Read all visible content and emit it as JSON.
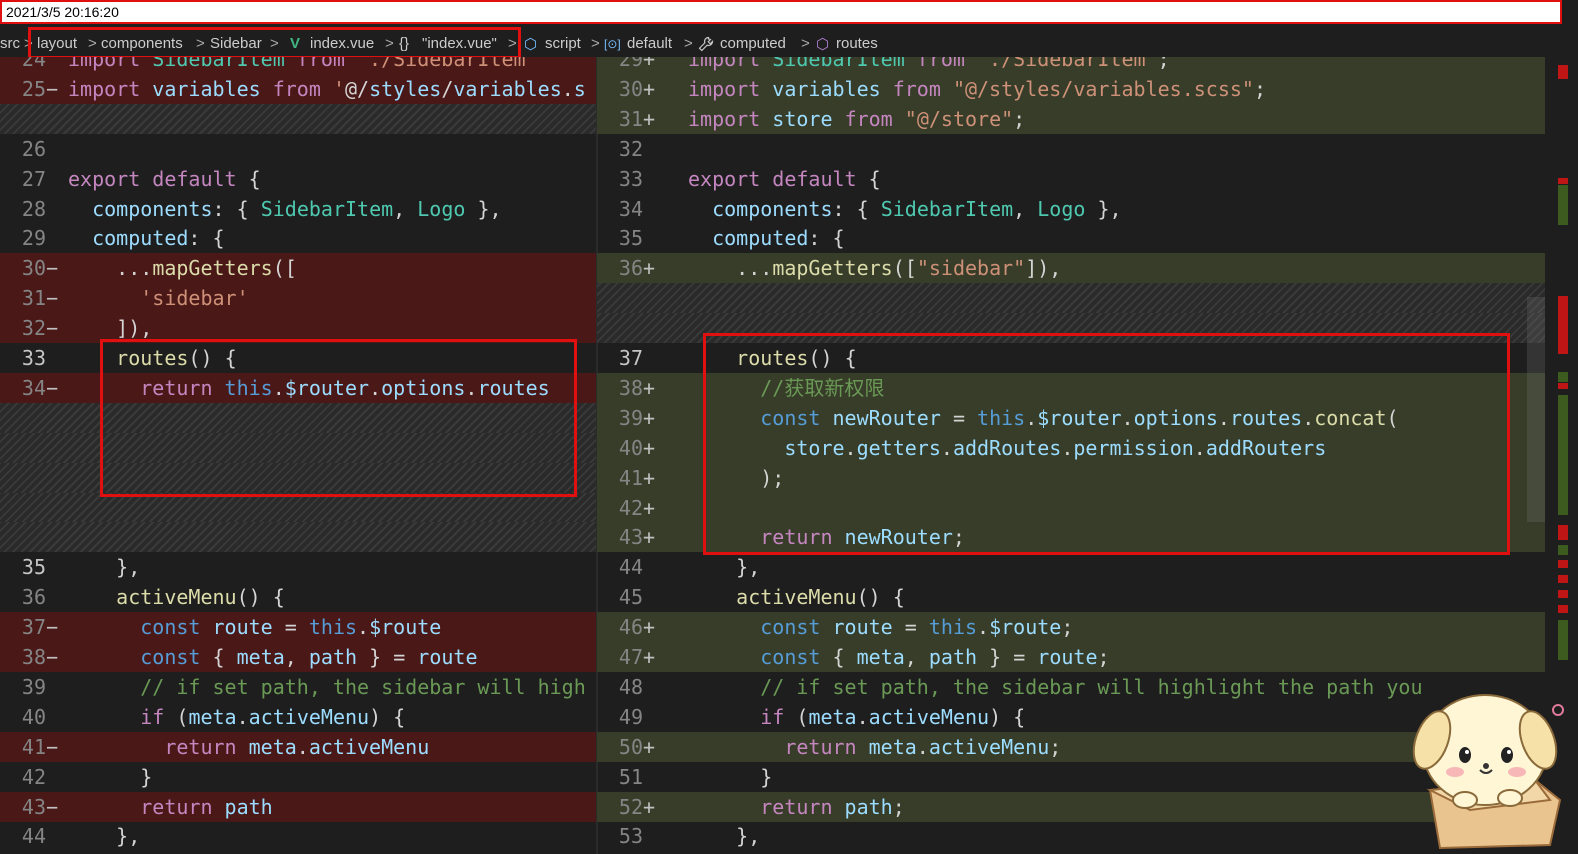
{
  "timestamp": "2021/3/5 20:16:20",
  "breadcrumb": {
    "items": [
      "src",
      "layout",
      "components",
      "Sidebar",
      "index.vue",
      "\"index.vue\"",
      "script",
      "default",
      "computed",
      "routes"
    ],
    "separator": ">",
    "icons": {
      "vue": "V",
      "braces": "{}",
      "cube": "⬡",
      "symbol": "[⊙]",
      "wrench": "🔧"
    }
  },
  "colors": {
    "deleted_line": "#4b1818",
    "inserted_line": "#373d29",
    "highlight_box": "#e01010"
  },
  "left": {
    "lines": [
      {
        "n": "24",
        "m": "",
        "t": "del",
        "code": "import SidebarItem from './SidebarItem'"
      },
      {
        "n": "25",
        "m": "−",
        "t": "del",
        "code": "import variables from '@/styles/variables.s"
      },
      {
        "n": "",
        "m": "",
        "t": "hatch",
        "code": ""
      },
      {
        "n": "26",
        "m": "",
        "t": "",
        "code": ""
      },
      {
        "n": "27",
        "m": "",
        "t": "",
        "code": "export default {"
      },
      {
        "n": "28",
        "m": "",
        "t": "",
        "code": "  components: { SidebarItem, Logo },"
      },
      {
        "n": "29",
        "m": "",
        "t": "",
        "code": "  computed: {"
      },
      {
        "n": "30",
        "m": "−",
        "t": "del",
        "code": "    ...mapGetters(["
      },
      {
        "n": "31",
        "m": "−",
        "t": "del",
        "code": "      'sidebar'"
      },
      {
        "n": "32",
        "m": "−",
        "t": "del",
        "code": "    ]),"
      },
      {
        "n": "33",
        "m": "",
        "t": "",
        "code": "    routes() {"
      },
      {
        "n": "34",
        "m": "−",
        "t": "del",
        "code": "      return this.$router.options.routes"
      },
      {
        "n": "",
        "m": "",
        "t": "hatch",
        "code": ""
      },
      {
        "n": "",
        "m": "",
        "t": "hatch",
        "code": ""
      },
      {
        "n": "",
        "m": "",
        "t": "hatch",
        "code": ""
      },
      {
        "n": "",
        "m": "",
        "t": "hatch",
        "code": ""
      },
      {
        "n": "",
        "m": "",
        "t": "hatch",
        "code": ""
      },
      {
        "n": "35",
        "m": "",
        "t": "",
        "code": "    },"
      },
      {
        "n": "36",
        "m": "",
        "t": "",
        "code": "    activeMenu() {"
      },
      {
        "n": "37",
        "m": "−",
        "t": "del",
        "code": "      const route = this.$route"
      },
      {
        "n": "38",
        "m": "−",
        "t": "del",
        "code": "      const { meta, path } = route"
      },
      {
        "n": "39",
        "m": "",
        "t": "",
        "code": "      // if set path, the sidebar will high"
      },
      {
        "n": "40",
        "m": "",
        "t": "",
        "code": "      if (meta.activeMenu) {"
      },
      {
        "n": "41",
        "m": "−",
        "t": "del",
        "code": "        return meta.activeMenu"
      },
      {
        "n": "42",
        "m": "",
        "t": "",
        "code": "      }"
      },
      {
        "n": "43",
        "m": "−",
        "t": "del",
        "code": "      return path"
      },
      {
        "n": "44",
        "m": "",
        "t": "",
        "code": "    },"
      }
    ]
  },
  "right": {
    "lines": [
      {
        "n": "29",
        "m": "+",
        "t": "ins",
        "code": "import SidebarItem from \"./SidebarItem\";"
      },
      {
        "n": "30",
        "m": "+",
        "t": "ins",
        "code": "import variables from \"@/styles/variables.scss\";"
      },
      {
        "n": "31",
        "m": "+",
        "t": "ins",
        "code": "import store from \"@/store\";"
      },
      {
        "n": "32",
        "m": "",
        "t": "",
        "code": ""
      },
      {
        "n": "33",
        "m": "",
        "t": "",
        "code": "export default {"
      },
      {
        "n": "34",
        "m": "",
        "t": "",
        "code": "  components: { SidebarItem, Logo },"
      },
      {
        "n": "35",
        "m": "",
        "t": "",
        "code": "  computed: {"
      },
      {
        "n": "36",
        "m": "+",
        "t": "ins",
        "code": "    ...mapGetters([\"sidebar\"]),"
      },
      {
        "n": "",
        "m": "",
        "t": "hatch",
        "code": ""
      },
      {
        "n": "",
        "m": "",
        "t": "hatch",
        "code": ""
      },
      {
        "n": "37",
        "m": "",
        "t": "",
        "code": "    routes() {"
      },
      {
        "n": "38",
        "m": "+",
        "t": "ins",
        "code": "      //获取新权限"
      },
      {
        "n": "39",
        "m": "+",
        "t": "ins",
        "code": "      const newRouter = this.$router.options.routes.concat("
      },
      {
        "n": "40",
        "m": "+",
        "t": "ins",
        "code": "        store.getters.addRoutes.permission.addRouters"
      },
      {
        "n": "41",
        "m": "+",
        "t": "ins",
        "code": "      );"
      },
      {
        "n": "42",
        "m": "+",
        "t": "ins",
        "code": ""
      },
      {
        "n": "43",
        "m": "+",
        "t": "ins",
        "code": "      return newRouter;"
      },
      {
        "n": "44",
        "m": "",
        "t": "",
        "code": "    },"
      },
      {
        "n": "45",
        "m": "",
        "t": "",
        "code": "    activeMenu() {"
      },
      {
        "n": "46",
        "m": "+",
        "t": "ins",
        "code": "      const route = this.$route;"
      },
      {
        "n": "47",
        "m": "+",
        "t": "ins",
        "code": "      const { meta, path } = route;"
      },
      {
        "n": "48",
        "m": "",
        "t": "",
        "code": "      // if set path, the sidebar will highlight the path you"
      },
      {
        "n": "49",
        "m": "",
        "t": "",
        "code": "      if (meta.activeMenu) {"
      },
      {
        "n": "50",
        "m": "+",
        "t": "ins",
        "code": "        return meta.activeMenu;"
      },
      {
        "n": "51",
        "m": "",
        "t": "",
        "code": "      }"
      },
      {
        "n": "52",
        "m": "+",
        "t": "ins",
        "code": "      return path;"
      },
      {
        "n": "53",
        "m": "",
        "t": "",
        "code": "    },"
      }
    ]
  }
}
